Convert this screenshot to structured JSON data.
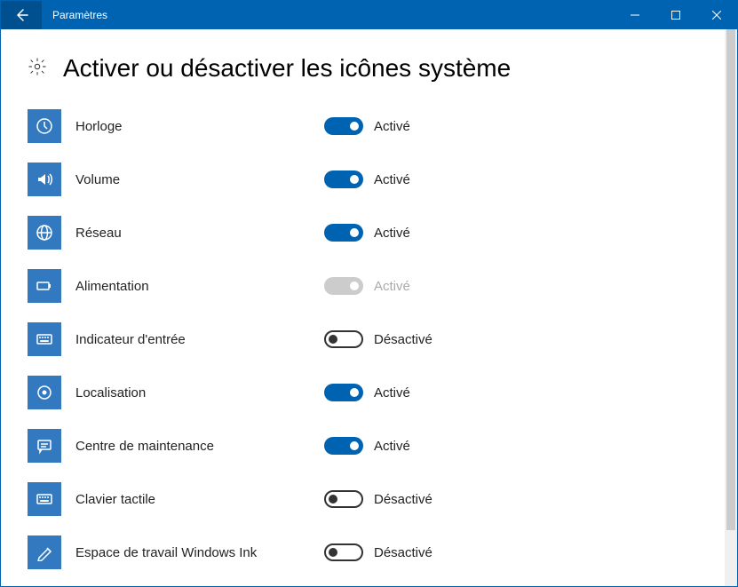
{
  "window": {
    "title": "Paramètres"
  },
  "page": {
    "heading": "Activer ou désactiver les icônes système"
  },
  "states": {
    "on": "Activé",
    "off": "Désactivé"
  },
  "options": [
    {
      "id": "clock",
      "label": "Horloge",
      "state": "on",
      "icon": "clock"
    },
    {
      "id": "volume",
      "label": "Volume",
      "state": "on",
      "icon": "volume"
    },
    {
      "id": "network",
      "label": "Réseau",
      "state": "on",
      "icon": "globe"
    },
    {
      "id": "power",
      "label": "Alimentation",
      "state": "disabled",
      "icon": "battery"
    },
    {
      "id": "input",
      "label": "Indicateur d'entrée",
      "state": "off",
      "icon": "keyboard"
    },
    {
      "id": "location",
      "label": "Localisation",
      "state": "on",
      "icon": "target"
    },
    {
      "id": "actioncenter",
      "label": "Centre de maintenance",
      "state": "on",
      "icon": "message"
    },
    {
      "id": "touchkbd",
      "label": "Clavier tactile",
      "state": "off",
      "icon": "keyboard"
    },
    {
      "id": "ink",
      "label": "Espace de travail Windows Ink",
      "state": "off",
      "icon": "pen"
    }
  ]
}
